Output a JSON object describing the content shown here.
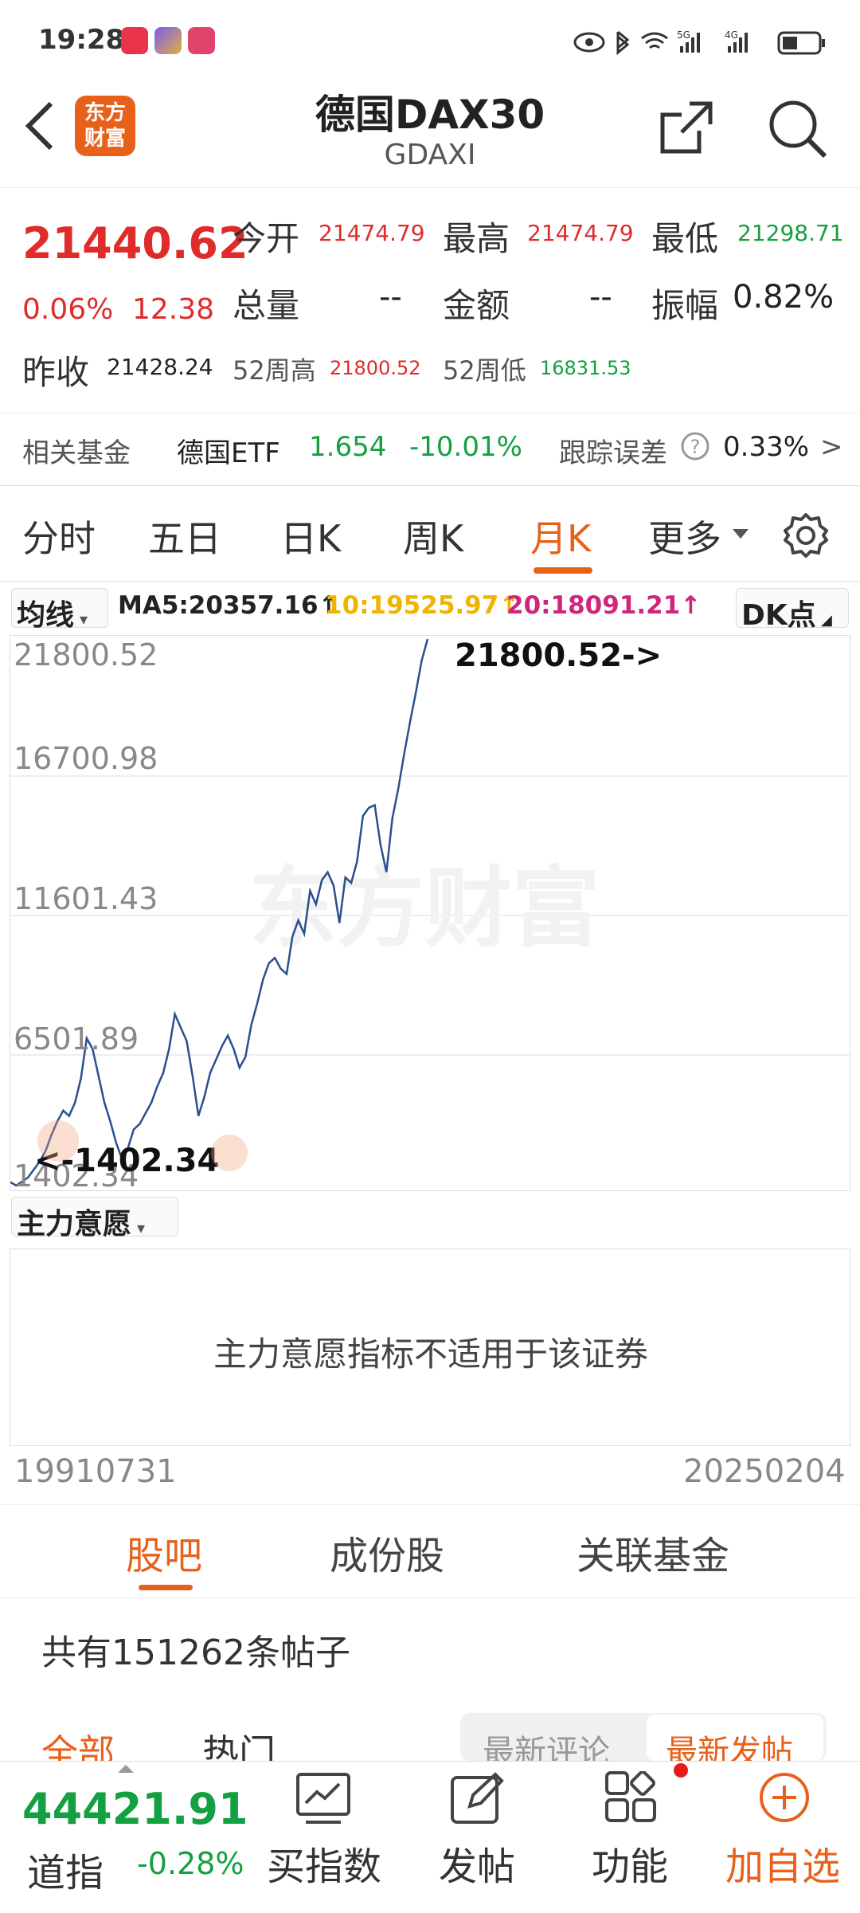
{
  "status": {
    "time": "19:28",
    "net1": "5G",
    "net2": "4G"
  },
  "header": {
    "logo_line1": "东方",
    "logo_line2": "财富",
    "title": "德国DAX30",
    "subtitle": "GDAXI"
  },
  "quote": {
    "price": "21440.62",
    "change_pct": "0.06%",
    "change": "12.38",
    "open_label": "今开",
    "open": "21474.79",
    "high_label": "最高",
    "high": "21474.79",
    "low_label": "最低",
    "low": "21298.71",
    "volume_label": "总量",
    "volume": "--",
    "amount_label": "金额",
    "amount": "--",
    "amplitude_label": "振幅",
    "amplitude": "0.82%",
    "prev_close_label": "昨收",
    "prev_close": "21428.24",
    "w52_high_label": "52周高",
    "w52_high": "21800.52",
    "w52_low_label": "52周低",
    "w52_low": "16831.53"
  },
  "fund": {
    "label": "相关基金",
    "name": "德国ETF",
    "price": "1.654",
    "change": "-10.01%",
    "track_label": "跟踪误差",
    "track_value": "0.33%",
    "arrow": ">"
  },
  "tabs": [
    "分时",
    "五日",
    "日K",
    "周K",
    "月K",
    "更多"
  ],
  "ma": {
    "selector": "均线",
    "ma5": "MA5:20357.16↑",
    "ma10": "10:19525.97↑",
    "ma20": "20:18091.21↑",
    "dk": "DK点"
  },
  "chart": {
    "y_labels": [
      "21800.52",
      "16700.98",
      "11601.43",
      "6501.89",
      "1402.34"
    ],
    "max_marker": "21800.52->",
    "min_marker": "<-1402.34",
    "watermark": "东方财富",
    "colors": {
      "line": "#2a4f8f"
    }
  },
  "chart_data": {
    "type": "line",
    "x_range": [
      "19910731",
      "20250204"
    ],
    "ylim": [
      1402.34,
      21800.52
    ],
    "series": [
      {
        "values": [
          1530,
          1402,
          1550,
          1700,
          2000,
          2300,
          2700,
          3300,
          3800,
          4200,
          4000,
          4500,
          5400,
          6900,
          6500,
          5500,
          4500,
          3800,
          3000,
          2400,
          2800,
          3500,
          3700,
          4100,
          4500,
          5100,
          5600,
          6500,
          7800,
          7300,
          6800,
          5500,
          4000,
          4700,
          5600,
          6100,
          6600,
          7000,
          6500,
          5800,
          6200,
          7400,
          8200,
          9100,
          9700,
          9900,
          9500,
          9300,
          10700,
          11300,
          10800,
          12400,
          11900,
          12800,
          13100,
          12600,
          11200,
          12900,
          12700,
          13500,
          15200,
          15500,
          15600,
          14100,
          13100,
          15100,
          16200,
          17500,
          18700,
          19800,
          21000,
          21800.52
        ]
      }
    ]
  },
  "subpanel": {
    "selector": "主力意愿",
    "message": "主力意愿指标不适用于该证券"
  },
  "dates": {
    "start": "19910731",
    "end": "20250204"
  },
  "bottom_tabs": [
    "股吧",
    "成份股",
    "关联基金"
  ],
  "posts": {
    "count_text": "共有151262条帖子",
    "filter_all": "全部",
    "filter_hot": "热门",
    "sort_comment": "最新评论",
    "sort_post": "最新发帖"
  },
  "nav": {
    "index_value": "44421.91",
    "index_name": "道指",
    "index_change": "-0.28%",
    "buy": "买指数",
    "post": "发帖",
    "func": "功能",
    "add": "加自选"
  }
}
